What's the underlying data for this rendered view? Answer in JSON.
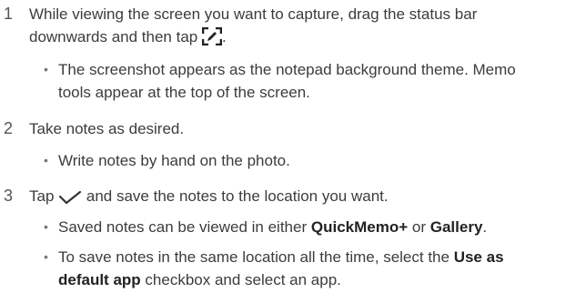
{
  "steps": [
    {
      "number": "1",
      "text_line1": "While viewing the screen you want to capture, drag the status bar",
      "text_line2_before": "downwards and then tap",
      "text_line2_after": ".",
      "icon": "edit-screenshot-icon",
      "bullets": [
        {
          "line1": "The screenshot appears as the notepad background theme. Memo",
          "line2": "tools appear at the top of the screen."
        }
      ]
    },
    {
      "number": "2",
      "text": "Take notes as desired.",
      "bullets": [
        {
          "line1": "Write notes by hand on the photo."
        }
      ]
    },
    {
      "number": "3",
      "text_before": "Tap",
      "text_after": "and save the notes to the location you want.",
      "icon": "checkmark-icon",
      "bullets": [
        {
          "before": "Saved notes can be viewed in either",
          "bold1": "QuickMemo+",
          "mid": "or",
          "bold2": "Gallery",
          "after": "."
        },
        {
          "line1_before": "To save notes in the same location all the time, select the",
          "line1_bold": "Use as",
          "line2_bold": "default app",
          "line2_after": "checkbox and select an app."
        }
      ]
    }
  ],
  "bullet_glyph": "•"
}
